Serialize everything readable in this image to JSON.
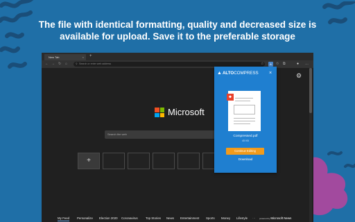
{
  "headline": {
    "line1": "The file with identical formatting, quality and decreased size is",
    "line2": "available for upload. Save it to the preferable storage"
  },
  "browser": {
    "tab_title": "New Tab",
    "tab_close": "×",
    "new_tab": "+",
    "address_placeholder": "Search or enter web address",
    "nav_back": "←",
    "nav_forward": "→",
    "nav_refresh": "↻",
    "nav_home": "⌂",
    "search_glass": "⚲",
    "ext_icon": "A",
    "star_icon": "☆",
    "fav_icon": "✩",
    "collections_icon": "⧉",
    "profile_icon": "●",
    "more_icon": "…"
  },
  "ntp": {
    "brand": "Microsoft",
    "logo_colors": [
      "#f25022",
      "#7fba00",
      "#00a4ef",
      "#ffb900"
    ],
    "search_placeholder": "Search the web",
    "gear": "⚙",
    "add_tile": "+",
    "feed": [
      "My Feed",
      "Personalize",
      "Election 2020",
      "Coronavirus",
      "Top Stories",
      "News",
      "Entertainment",
      "Sports",
      "Money",
      "Lifestyle"
    ],
    "feed_more": "···",
    "powered_by": "powered by",
    "powered_brand": "Microsoft News"
  },
  "popup": {
    "brand_main": "ALTO",
    "brand_rest": "COMPRESS",
    "close": "×",
    "pdf_badge": "⬥",
    "file_name": "Compressed.pdf",
    "file_size": "45 KB",
    "continue_label": "Continue Editing",
    "download_label": "Download"
  },
  "colors": {
    "background": "#1f6fa7",
    "popup": "#1f7fd0",
    "continue_button": "#f29b1b",
    "pdf_red": "#e8412c"
  }
}
